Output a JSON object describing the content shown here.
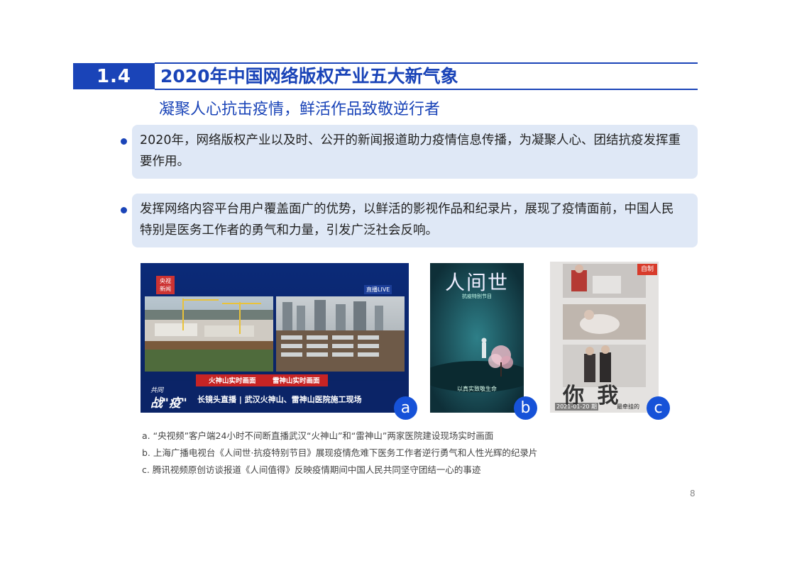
{
  "header": {
    "section_number": "1.4",
    "title": "2020年中国网络版权产业五大新气象",
    "subtitle": "凝聚人心抗击疫情，鲜活作品致敬逆行者"
  },
  "bullets": [
    {
      "line1": "2020年，网络版权产业以及时、公开的新闻报道助力疫情信息传播，为凝聚人心、团结抗疫发挥重",
      "line2": "要作用。"
    },
    {
      "line1": "发挥网络内容平台用户覆盖面广的优势，以鲜活的影视作品和纪录片，展现了疫情面前，中国人民",
      "line2": "特别是医务工作者的勇气和力量，引发广泛社会反响。"
    }
  ],
  "images": {
    "a": {
      "badge": "a",
      "logo_top": "央视",
      "logo_bottom": "新闻",
      "live_tag": "直播LIVE",
      "label_left": "火神山实时画面",
      "label_right": "雷神山实时画面",
      "slogan_small": "共同",
      "slogan_big": "战\"疫\"",
      "banner": "长镜头直播 | 武汉火神山、雷神山医院施工现场"
    },
    "b": {
      "badge": "b",
      "poster_title": "人间世",
      "poster_sub": "抗疫特别节目",
      "poster_tagline": "以真实致敬生命"
    },
    "c": {
      "badge": "c",
      "tag": "自制",
      "big_text": "你 我",
      "date": "2021-01-20 期",
      "side_text": "最牵挂的"
    }
  },
  "captions": [
    "a. “央视频”客户端24小时不间断直播武汉“火神山”和“雷神山”两家医院建设现场实时画面",
    "b. 上海广播电视台《人间世·抗疫特别节目》展现疫情危难下医务工作者逆行勇气和人性光辉的纪录片",
    "c.  腾讯视频原创访谈报道《人间值得》反映疫情期间中国人民共同坚守团结一心的事迹"
  ],
  "page_number": "8"
}
